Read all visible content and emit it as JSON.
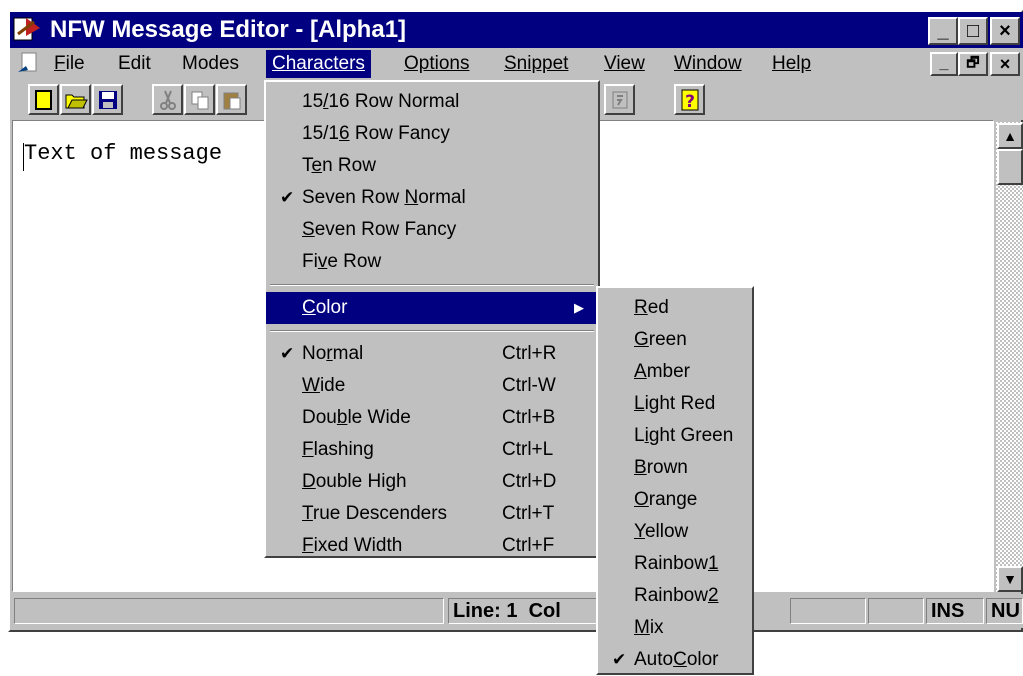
{
  "window": {
    "title": "NFW Message Editor - [Alpha1]",
    "caption_buttons": {
      "minimize": "_",
      "maximize": "□",
      "close": "×"
    },
    "mdi_buttons": {
      "minimize": "_",
      "restore": "🗗",
      "close": "×"
    }
  },
  "menubar": {
    "file": "File",
    "edit": "Edit",
    "modes": "Modes",
    "characters": "Characters",
    "options": "Options",
    "snippet": "Snippet",
    "view": "View",
    "window": "Window",
    "help": "Help"
  },
  "toolbar": {
    "icons": [
      "new-document-icon",
      "open-folder-icon",
      "save-disk-icon",
      "cut-scissors-icon",
      "copy-icon",
      "paste-icon",
      "snippet-icon",
      "help-question-icon"
    ]
  },
  "editor": {
    "text": "Text of message"
  },
  "statusbar": {
    "line": "Line: 1",
    "col": "Col",
    "ins": "INS",
    "num": "NU"
  },
  "characters_menu": {
    "fonts": [
      {
        "pre": "15",
        "u": "/",
        "post": "16 Row Normal",
        "checked": false
      },
      {
        "pre": "15/1",
        "u": "6",
        "post": " Row Fancy",
        "checked": false
      },
      {
        "pre": "T",
        "u": "e",
        "post": "n Row",
        "checked": false
      },
      {
        "pre": "Seven Row ",
        "u": "N",
        "post": "ormal",
        "checked": true
      },
      {
        "pre": "",
        "u": "S",
        "post": "even Row Fancy",
        "checked": false
      },
      {
        "pre": "Fi",
        "u": "v",
        "post": "e Row",
        "checked": false
      }
    ],
    "color": {
      "pre": "",
      "u": "C",
      "post": "olor"
    },
    "styles": [
      {
        "pre": "No",
        "u": "r",
        "post": "mal",
        "shortcut": "Ctrl+R",
        "checked": true
      },
      {
        "pre": "",
        "u": "W",
        "post": "ide",
        "shortcut": "Ctrl-W",
        "checked": false
      },
      {
        "pre": "Dou",
        "u": "b",
        "post": "le Wide",
        "shortcut": "Ctrl+B",
        "checked": false
      },
      {
        "pre": "",
        "u": "F",
        "post": "lashing",
        "shortcut": "Ctrl+L",
        "checked": false
      },
      {
        "pre": "",
        "u": "D",
        "post": "ouble High",
        "shortcut": "Ctrl+D",
        "checked": false
      },
      {
        "pre": "",
        "u": "T",
        "post": "rue Descenders",
        "shortcut": "Ctrl+T",
        "checked": false
      },
      {
        "pre": "",
        "u": "F",
        "post": "ixed Width",
        "shortcut": "Ctrl+F",
        "checked": false
      }
    ]
  },
  "color_menu": {
    "items": [
      {
        "pre": "",
        "u": "R",
        "post": "ed",
        "checked": false
      },
      {
        "pre": "",
        "u": "G",
        "post": "reen",
        "checked": false
      },
      {
        "pre": "",
        "u": "A",
        "post": "mber",
        "checked": false
      },
      {
        "pre": "",
        "u": "L",
        "post": "ight Red",
        "checked": false
      },
      {
        "pre": "L",
        "u": "i",
        "post": "ght Green",
        "checked": false
      },
      {
        "pre": "",
        "u": "B",
        "post": "rown",
        "checked": false
      },
      {
        "pre": "",
        "u": "O",
        "post": "range",
        "checked": false
      },
      {
        "pre": "",
        "u": "Y",
        "post": "ellow",
        "checked": false
      },
      {
        "pre": "Rainbow",
        "u": "1",
        "post": "",
        "checked": false
      },
      {
        "pre": "Rainbow",
        "u": "2",
        "post": "",
        "checked": false
      },
      {
        "pre": "",
        "u": "M",
        "post": "ix",
        "checked": false
      },
      {
        "pre": "Auto",
        "u": "C",
        "post": "olor",
        "checked": true
      }
    ]
  },
  "colors": {
    "titlebar": "#000080",
    "face": "#c0c0c0",
    "highlight": "#000080"
  }
}
